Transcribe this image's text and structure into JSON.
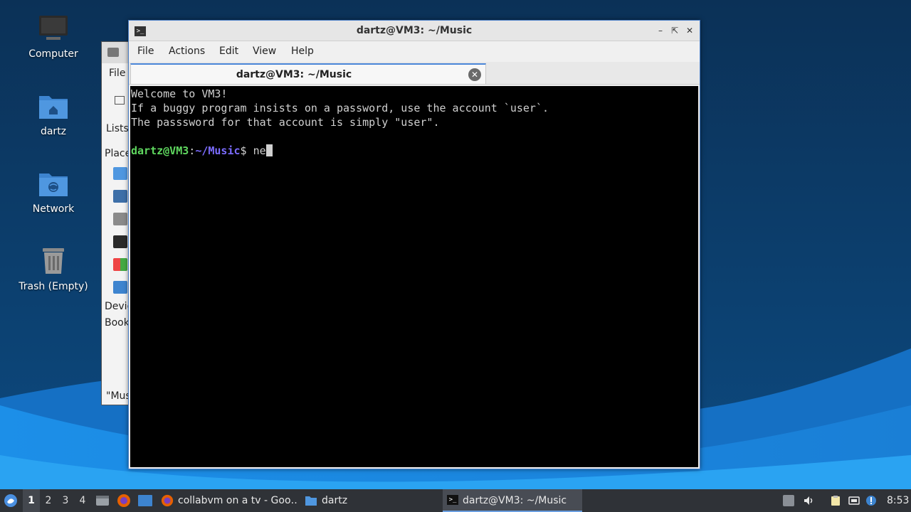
{
  "desktop": {
    "icons": [
      {
        "label": "Computer"
      },
      {
        "label": "dartz"
      },
      {
        "label": "Network"
      },
      {
        "label": "Trash (Empty)"
      }
    ]
  },
  "file_manager": {
    "menu_file": "File",
    "tab_lists": "Lists",
    "section_places": "Place",
    "section_devices": "Devic",
    "section_bookmarks": "Book",
    "status": "\"Mus"
  },
  "terminal": {
    "title": "dartz@VM3: ~/Music",
    "menu": [
      "File",
      "Actions",
      "Edit",
      "View",
      "Help"
    ],
    "tab_label": "dartz@VM3: ~/Music",
    "lines": [
      "Welcome to VM3!",
      "If a buggy program insists on a password, use the account `user`.",
      "The passsword for that account is simply \"user\"."
    ],
    "prompt_user": "dartz@VM3",
    "prompt_sep": ":",
    "prompt_path": "~/Music",
    "prompt_symbol": "$ ",
    "input_text": "ne"
  },
  "taskbar": {
    "workspaces": [
      "1",
      "2",
      "3",
      "4"
    ],
    "tasks": [
      {
        "label": "collabvm on a tv - Goo…"
      },
      {
        "label": "dartz"
      },
      {
        "label": "dartz@VM3: ~/Music"
      }
    ],
    "clock": "8:53"
  },
  "colors": {
    "accent": "#4a86d8",
    "prompt_user": "#5fd75f",
    "prompt_path": "#7b6cff",
    "taskbar_bg": "#2f3237"
  }
}
